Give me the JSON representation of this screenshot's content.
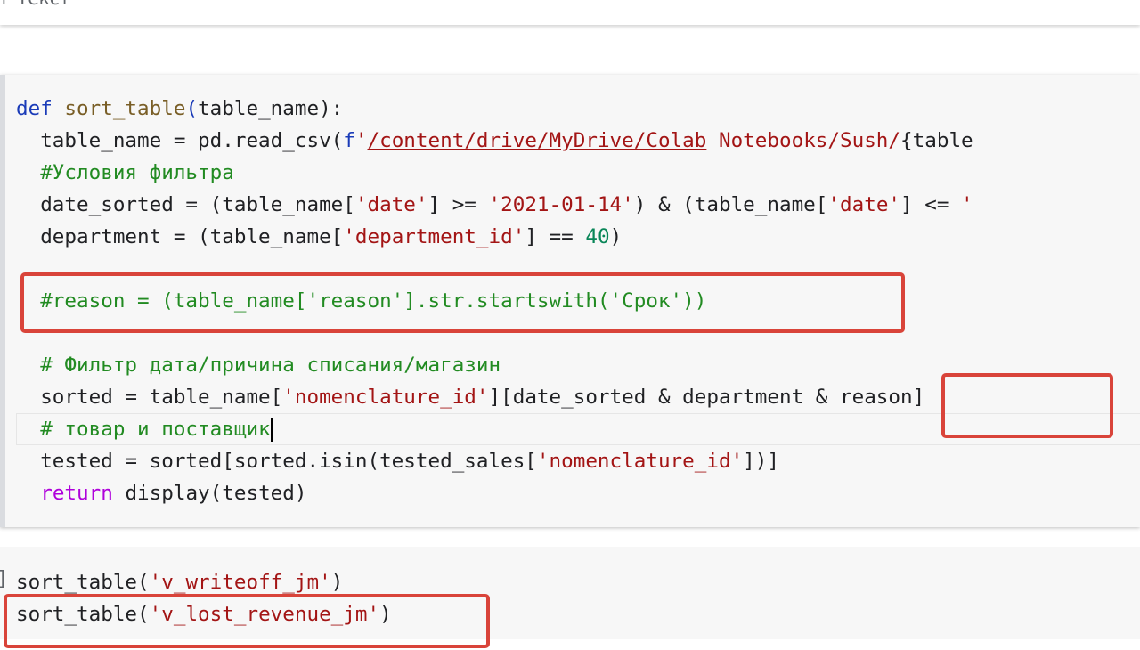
{
  "toolbar": {
    "add_text_label": "+ Текст"
  },
  "code_cell": {
    "l1_def": "def",
    "l1_name": "sort_table",
    "l1_open": "(",
    "l1_param": "table_name",
    "l1_close": "):",
    "l2_a": "  table_name = pd.read_csv(",
    "l2_f": "f",
    "l2_q": "'",
    "l2_path": "/content/drive/MyDrive/Colab",
    "l2_rest": " Notebooks/Sush/",
    "l2_tail": "{table",
    "l3": "  #Условия фильтра",
    "l4_a": "  date_sorted = (table_name[",
    "l4_s1": "'date'",
    "l4_b": "] >= ",
    "l4_s2": "'2021-01-14'",
    "l4_c": ") & (table_name[",
    "l4_s3": "'date'",
    "l4_d": "] <= ",
    "l4_s4": "'",
    "l5_a": "  department = (table_name[",
    "l5_s1": "'department_id'",
    "l5_b": "] == ",
    "l5_num": "40",
    "l5_c": ")",
    "l6": "  #reason = (table_name['reason'].str.startswith('Срок'))",
    "l7": "  # Фильтр дата/причина списания/магазин",
    "l8_a": "  sorted = table_name[",
    "l8_s1": "'nomenclature_id'",
    "l8_b": "][date_sorted & department & reason]",
    "l9": "  # товар и поставщик",
    "l10_a": "  tested = sorted[sorted.isin(tested_sales[",
    "l10_s1": "'nomenclature_id'",
    "l10_b": "])]",
    "l11_ret": "return",
    "l11_rest": " display(tested)"
  },
  "call_cell": {
    "bracket": "]",
    "c1_a": "sort_table(",
    "c1_s": "'v_writeoff_jm'",
    "c1_b": ")",
    "c2_a": "sort_table(",
    "c2_s": "'v_lost_revenue_jm'",
    "c2_b": ")"
  }
}
